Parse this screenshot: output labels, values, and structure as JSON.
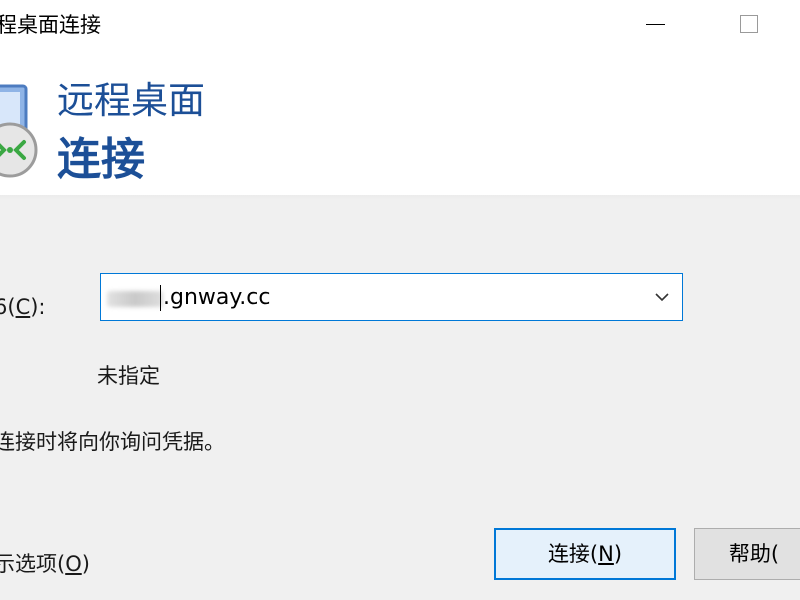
{
  "window": {
    "title": "程桌面连接"
  },
  "banner": {
    "line1": "远程桌面",
    "line2": "连接"
  },
  "form": {
    "computer_label_prefix": "6(",
    "computer_label_key": "C",
    "computer_label_suffix": "):",
    "computer_value": ".gnway.cc",
    "user_label": ":",
    "user_value": "未指定",
    "note": "连接时将向你询问凭据。"
  },
  "footer": {
    "options_prefix": "示选项(",
    "options_key": "O",
    "options_suffix": ")",
    "connect_prefix": "连接(",
    "connect_key": "N",
    "connect_suffix": ")",
    "help_prefix": "帮助("
  },
  "colors": {
    "accent": "#0078d7",
    "banner_text": "#1c4f97"
  },
  "icons": {
    "app": "remote-desktop-icon",
    "dropdown": "chevron-down-icon"
  }
}
